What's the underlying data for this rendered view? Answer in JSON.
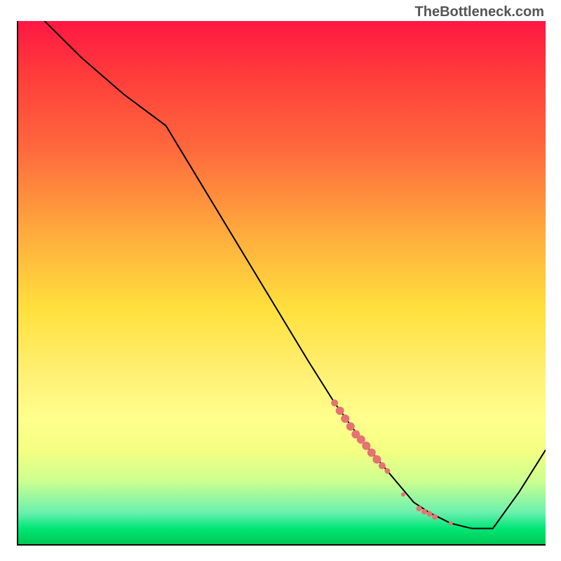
{
  "watermark": "TheBottleneck.com",
  "chart_data": {
    "type": "line",
    "title": "",
    "xlabel": "",
    "ylabel": "",
    "xlim": [
      0,
      100
    ],
    "ylim": [
      0,
      100
    ],
    "grid": false,
    "series": [
      {
        "name": "bottleneck-curve",
        "x": [
          0,
          5,
          12,
          20,
          28,
          55,
          60,
          65,
          70,
          75,
          78,
          82,
          86,
          90,
          95,
          100
        ],
        "y": [
          104,
          100,
          93,
          86,
          80,
          35,
          27,
          20,
          14,
          8,
          6,
          4,
          3,
          3,
          10,
          18
        ],
        "color": "#000000"
      }
    ],
    "markers": [
      {
        "name": "bottleneck-cluster",
        "color": "#e57373",
        "points": [
          {
            "x": 60,
            "y": 27,
            "r": 5
          },
          {
            "x": 61,
            "y": 25.5,
            "r": 6
          },
          {
            "x": 62,
            "y": 24,
            "r": 6
          },
          {
            "x": 63,
            "y": 22.5,
            "r": 6
          },
          {
            "x": 64,
            "y": 21,
            "r": 6
          },
          {
            "x": 65,
            "y": 20,
            "r": 6
          },
          {
            "x": 66,
            "y": 18.8,
            "r": 6
          },
          {
            "x": 67,
            "y": 17.5,
            "r": 6
          },
          {
            "x": 68,
            "y": 16.2,
            "r": 6
          },
          {
            "x": 69,
            "y": 15,
            "r": 5
          },
          {
            "x": 70,
            "y": 14,
            "r": 4
          },
          {
            "x": 73,
            "y": 9.5,
            "r": 3
          },
          {
            "x": 76,
            "y": 6.8,
            "r": 4
          },
          {
            "x": 77,
            "y": 6.2,
            "r": 4
          },
          {
            "x": 78,
            "y": 5.8,
            "r": 4
          },
          {
            "x": 79,
            "y": 5.2,
            "r": 4
          },
          {
            "x": 82,
            "y": 4,
            "r": 3
          }
        ]
      }
    ],
    "background_gradient": {
      "top": "#ff1744",
      "bottom": "#00c853"
    }
  }
}
